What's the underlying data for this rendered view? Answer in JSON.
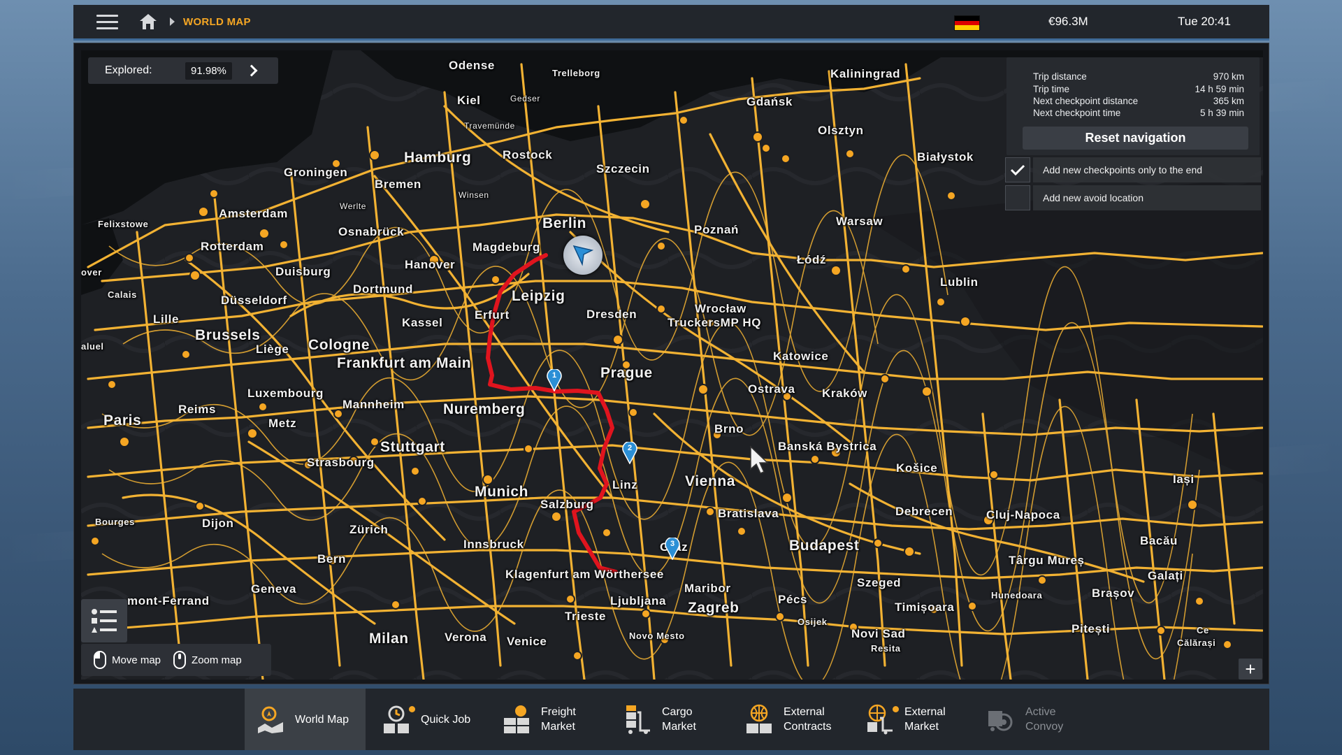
{
  "topbar": {
    "breadcrumb": "WORLD MAP",
    "money": "€96.3M",
    "time": "Tue 20:41",
    "flag_colors": [
      "#000000",
      "#dd0000",
      "#ffce00"
    ]
  },
  "explored": {
    "label": "Explored:",
    "value": "91.98%"
  },
  "navigation": {
    "rows": [
      {
        "label": "Trip distance",
        "value": "970 km"
      },
      {
        "label": "Trip time",
        "value": "14 h 59 min"
      },
      {
        "label": "Next checkpoint distance",
        "value": "365 km"
      },
      {
        "label": "Next checkpoint time",
        "value": "5 h 39 min"
      }
    ],
    "reset_label": "Reset navigation",
    "options": [
      {
        "label": "Add new checkpoints only to the end",
        "checked": true
      },
      {
        "label": "Add new avoid location",
        "checked": false
      }
    ]
  },
  "hints": {
    "move": "Move map",
    "zoom": "Zoom map"
  },
  "checkpoints": [
    "1",
    "2",
    "3"
  ],
  "cities": {
    "odense": "Odense",
    "trelleborg": "Trelleborg",
    "kaliningrad": "Kaliningrad",
    "kiel": "Kiel",
    "gedser": "Gedser",
    "gdansk": "Gdańsk",
    "travemunde": "Travemünde",
    "rostock": "Rostock",
    "olsztyn": "Olsztyn",
    "hamburg": "Hamburg",
    "bialystok": "Białystok",
    "groningen": "Groningen",
    "szczecin": "Szczecin",
    "bremen": "Bremen",
    "winsen": "Winsen",
    "werlte": "Werlte",
    "amsterdam": "Amsterdam",
    "berlin": "Berlin",
    "warsaw": "Warsaw",
    "felixstowe": "Felixstowe",
    "osnabruck": "Osnabrück",
    "poznan": "Poznań",
    "rotterdam": "Rotterdam",
    "magdeburg": "Magdeburg",
    "hanover": "Hanover",
    "lodz": "Łódź",
    "dover": "over",
    "duisburg": "Duisburg",
    "dortmund": "Dortmund",
    "lublin": "Lublin",
    "calais": "Calais",
    "leipzig": "Leipzig",
    "dusseldorf": "Düsseldorf",
    "wroclaw": "Wrocław",
    "dresden": "Dresden",
    "erfurt": "Erfurt",
    "lille": "Lille",
    "kassel": "Kassel",
    "truckersmp": "TruckersMP HQ",
    "brussels": "Brussels",
    "cologne": "Cologne",
    "aluel": "aluel",
    "liege": "Liège",
    "katowice": "Katowice",
    "frankfurt": "Frankfurt am Main",
    "prague": "Prague",
    "ostrava": "Ostrava",
    "krakow": "Kraków",
    "luxembourg": "Luxembourg",
    "reims": "Reims",
    "mannheim": "Mannheim",
    "nuremberg": "Nuremberg",
    "paris": "Paris",
    "metz": "Metz",
    "brno": "Brno",
    "stuttgart": "Stuttgart",
    "banska": "Banská Bystrica",
    "strasbourg": "Strasbourg",
    "kosice": "Košice",
    "linz": "Linz",
    "vienna": "Vienna",
    "iasi": "Iași",
    "munich": "Munich",
    "salzburg": "Salzburg",
    "bratislava": "Bratislava",
    "debrecen": "Debrecen",
    "cluj": "Cluj-Napoca",
    "bourges": "Bourges",
    "dijon": "Dijon",
    "zurich": "Zürich",
    "graz": "Graz",
    "bacau": "Bacău",
    "innsbruck": "Innsbruck",
    "budapest": "Budapest",
    "targu": "Târgu Mureș",
    "bern": "Bern",
    "klagenfurt": "Klagenfurt am Wörthersee",
    "szeged": "Szeged",
    "galati": "Galați",
    "clermont": "mont-Ferrand",
    "geneva": "Geneva",
    "maribor": "Maribor",
    "brasov": "Brașov",
    "ljubljana": "Ljubljana",
    "hunedoara": "Hunedoara",
    "pecs": "Pécs",
    "zagreb": "Zagreb",
    "timisoara": "Timișoara",
    "trieste": "Trieste",
    "osijek": "Osijek",
    "pitesti": "Pitești",
    "milan": "Milan",
    "verona": "Verona",
    "venice": "Venice",
    "novomesto": "Novo Mesto",
    "novisad": "Novi Sad",
    "calarasi": "Călărași",
    "resita": "Resita",
    "ce": "Ce"
  },
  "tabs": [
    {
      "label": "World Map",
      "icon": "world-map-icon",
      "active": true,
      "dot": false,
      "disabled": false
    },
    {
      "label": "Quick Job",
      "icon": "quick-job-icon",
      "active": false,
      "dot": true,
      "disabled": false
    },
    {
      "label": "Freight\nMarket",
      "icon": "freight-market-icon",
      "active": false,
      "dot": false,
      "disabled": false
    },
    {
      "label": "Cargo\nMarket",
      "icon": "cargo-market-icon",
      "active": false,
      "dot": false,
      "disabled": false
    },
    {
      "label": "External\nContracts",
      "icon": "external-contracts-icon",
      "active": false,
      "dot": false,
      "disabled": false
    },
    {
      "label": "External\nMarket",
      "icon": "external-market-icon",
      "active": false,
      "dot": true,
      "disabled": false
    },
    {
      "label": "Active\nConvoy",
      "icon": "active-convoy-icon",
      "active": false,
      "dot": false,
      "disabled": true
    }
  ],
  "colors": {
    "accent": "#f5a623",
    "road": "#f2b233",
    "route": "#e0141e",
    "checkpoint": "#2b8fd6"
  }
}
